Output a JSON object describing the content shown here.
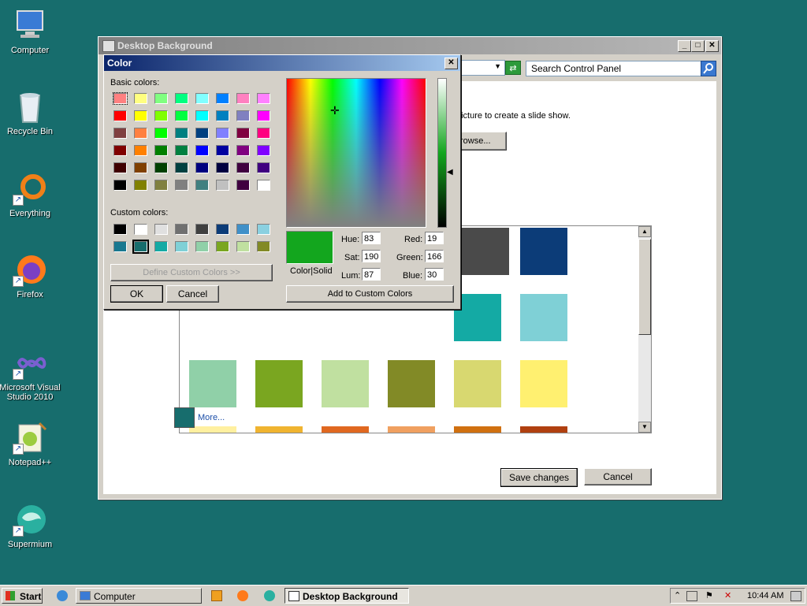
{
  "desktop": {
    "icons": [
      {
        "label": "Computer"
      },
      {
        "label": "Recycle Bin"
      },
      {
        "label": "Everything"
      },
      {
        "label": "Firefox"
      },
      {
        "label": "Microsoft Visual Studio 2010"
      },
      {
        "label": "Notepad++"
      },
      {
        "label": "Supermium"
      }
    ]
  },
  "bg_window": {
    "title": "Desktop Background",
    "search_placeholder": "Search Control Panel",
    "instruction_text": "picture to create a slide show.",
    "browse_label": "rowse...",
    "more_label": "More...",
    "save_label": "Save changes",
    "cancel_label": "Cancel",
    "swatch_colors": [
      "#4a4a4a",
      "#0c3c78",
      "#14aaa4",
      "#7fd0d6",
      "#90d0a8",
      "#7aa620",
      "#c0e0a0",
      "#828a26",
      "#d8d870",
      "#fff070",
      "#fff0a0",
      "#f0b430",
      "#e06820",
      "#f0a060",
      "#d07010",
      "#b04010"
    ],
    "more_swatch_color": "#176d6d"
  },
  "color_dialog": {
    "title": "Color",
    "basic_label": "Basic colors:",
    "custom_label": "Custom colors:",
    "define_label": "Define Custom Colors >>",
    "ok_label": "OK",
    "cancel_label": "Cancel",
    "add_label": "Add to Custom Colors",
    "colorsolid_label": "Color|Solid",
    "preview_color": "#13a61e",
    "basic_colors": [
      "#ff8080",
      "#ffff80",
      "#80ff80",
      "#00ff80",
      "#80ffff",
      "#0080ff",
      "#ff80c0",
      "#ff80ff",
      "#ff0000",
      "#ffff00",
      "#80ff00",
      "#00ff40",
      "#00ffff",
      "#0080c0",
      "#8080c0",
      "#ff00ff",
      "#804040",
      "#ff8040",
      "#00ff00",
      "#008080",
      "#004080",
      "#8080ff",
      "#800040",
      "#ff0080",
      "#800000",
      "#ff8000",
      "#008000",
      "#008040",
      "#0000ff",
      "#0000a0",
      "#800080",
      "#8000ff",
      "#400000",
      "#804000",
      "#004000",
      "#004040",
      "#000080",
      "#000040",
      "#400040",
      "#400080",
      "#000000",
      "#808000",
      "#808040",
      "#808080",
      "#408080",
      "#c0c0c0",
      "#400040",
      "#ffffff"
    ],
    "custom_colors": [
      "#000000",
      "#ffffff",
      "#e0e0e0",
      "#707070",
      "#404040",
      "#0c3c78",
      "#4090c8",
      "#8ad0e0",
      "#187890",
      "#176d6d",
      "#14aaa4",
      "#7fd0d6",
      "#90d0a8",
      "#7aa620",
      "#c0e0a0",
      "#828a26"
    ],
    "fields": {
      "hue_label": "Hue:",
      "hue": "83",
      "sat_label": "Sat:",
      "sat": "190",
      "lum_label": "Lum:",
      "lum": "87",
      "red_label": "Red:",
      "red": "19",
      "green_label": "Green:",
      "green": "166",
      "blue_label": "Blue:",
      "blue": "30"
    }
  },
  "taskbar": {
    "start_label": "Start",
    "computer_label": "Computer",
    "active_label": "Desktop Background",
    "clock": "10:44 AM"
  }
}
